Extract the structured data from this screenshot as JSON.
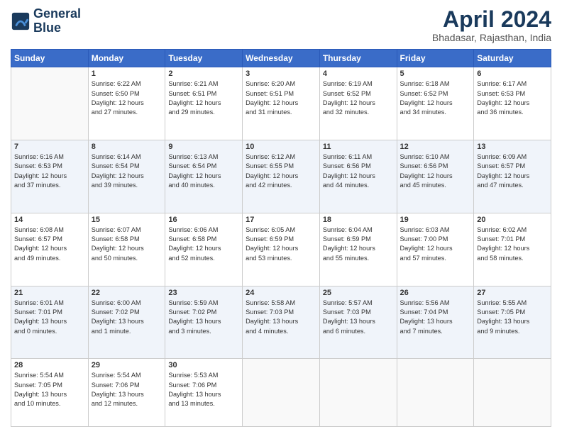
{
  "header": {
    "logo_line1": "General",
    "logo_line2": "Blue",
    "title": "April 2024",
    "location": "Bhadasar, Rajasthan, India"
  },
  "days_of_week": [
    "Sunday",
    "Monday",
    "Tuesday",
    "Wednesday",
    "Thursday",
    "Friday",
    "Saturday"
  ],
  "weeks": [
    [
      {
        "day": "",
        "info": ""
      },
      {
        "day": "1",
        "info": "Sunrise: 6:22 AM\nSunset: 6:50 PM\nDaylight: 12 hours\nand 27 minutes."
      },
      {
        "day": "2",
        "info": "Sunrise: 6:21 AM\nSunset: 6:51 PM\nDaylight: 12 hours\nand 29 minutes."
      },
      {
        "day": "3",
        "info": "Sunrise: 6:20 AM\nSunset: 6:51 PM\nDaylight: 12 hours\nand 31 minutes."
      },
      {
        "day": "4",
        "info": "Sunrise: 6:19 AM\nSunset: 6:52 PM\nDaylight: 12 hours\nand 32 minutes."
      },
      {
        "day": "5",
        "info": "Sunrise: 6:18 AM\nSunset: 6:52 PM\nDaylight: 12 hours\nand 34 minutes."
      },
      {
        "day": "6",
        "info": "Sunrise: 6:17 AM\nSunset: 6:53 PM\nDaylight: 12 hours\nand 36 minutes."
      }
    ],
    [
      {
        "day": "7",
        "info": "Sunrise: 6:16 AM\nSunset: 6:53 PM\nDaylight: 12 hours\nand 37 minutes."
      },
      {
        "day": "8",
        "info": "Sunrise: 6:14 AM\nSunset: 6:54 PM\nDaylight: 12 hours\nand 39 minutes."
      },
      {
        "day": "9",
        "info": "Sunrise: 6:13 AM\nSunset: 6:54 PM\nDaylight: 12 hours\nand 40 minutes."
      },
      {
        "day": "10",
        "info": "Sunrise: 6:12 AM\nSunset: 6:55 PM\nDaylight: 12 hours\nand 42 minutes."
      },
      {
        "day": "11",
        "info": "Sunrise: 6:11 AM\nSunset: 6:56 PM\nDaylight: 12 hours\nand 44 minutes."
      },
      {
        "day": "12",
        "info": "Sunrise: 6:10 AM\nSunset: 6:56 PM\nDaylight: 12 hours\nand 45 minutes."
      },
      {
        "day": "13",
        "info": "Sunrise: 6:09 AM\nSunset: 6:57 PM\nDaylight: 12 hours\nand 47 minutes."
      }
    ],
    [
      {
        "day": "14",
        "info": "Sunrise: 6:08 AM\nSunset: 6:57 PM\nDaylight: 12 hours\nand 49 minutes."
      },
      {
        "day": "15",
        "info": "Sunrise: 6:07 AM\nSunset: 6:58 PM\nDaylight: 12 hours\nand 50 minutes."
      },
      {
        "day": "16",
        "info": "Sunrise: 6:06 AM\nSunset: 6:58 PM\nDaylight: 12 hours\nand 52 minutes."
      },
      {
        "day": "17",
        "info": "Sunrise: 6:05 AM\nSunset: 6:59 PM\nDaylight: 12 hours\nand 53 minutes."
      },
      {
        "day": "18",
        "info": "Sunrise: 6:04 AM\nSunset: 6:59 PM\nDaylight: 12 hours\nand 55 minutes."
      },
      {
        "day": "19",
        "info": "Sunrise: 6:03 AM\nSunset: 7:00 PM\nDaylight: 12 hours\nand 57 minutes."
      },
      {
        "day": "20",
        "info": "Sunrise: 6:02 AM\nSunset: 7:01 PM\nDaylight: 12 hours\nand 58 minutes."
      }
    ],
    [
      {
        "day": "21",
        "info": "Sunrise: 6:01 AM\nSunset: 7:01 PM\nDaylight: 13 hours\nand 0 minutes."
      },
      {
        "day": "22",
        "info": "Sunrise: 6:00 AM\nSunset: 7:02 PM\nDaylight: 13 hours\nand 1 minute."
      },
      {
        "day": "23",
        "info": "Sunrise: 5:59 AM\nSunset: 7:02 PM\nDaylight: 13 hours\nand 3 minutes."
      },
      {
        "day": "24",
        "info": "Sunrise: 5:58 AM\nSunset: 7:03 PM\nDaylight: 13 hours\nand 4 minutes."
      },
      {
        "day": "25",
        "info": "Sunrise: 5:57 AM\nSunset: 7:03 PM\nDaylight: 13 hours\nand 6 minutes."
      },
      {
        "day": "26",
        "info": "Sunrise: 5:56 AM\nSunset: 7:04 PM\nDaylight: 13 hours\nand 7 minutes."
      },
      {
        "day": "27",
        "info": "Sunrise: 5:55 AM\nSunset: 7:05 PM\nDaylight: 13 hours\nand 9 minutes."
      }
    ],
    [
      {
        "day": "28",
        "info": "Sunrise: 5:54 AM\nSunset: 7:05 PM\nDaylight: 13 hours\nand 10 minutes."
      },
      {
        "day": "29",
        "info": "Sunrise: 5:54 AM\nSunset: 7:06 PM\nDaylight: 13 hours\nand 12 minutes."
      },
      {
        "day": "30",
        "info": "Sunrise: 5:53 AM\nSunset: 7:06 PM\nDaylight: 13 hours\nand 13 minutes."
      },
      {
        "day": "",
        "info": ""
      },
      {
        "day": "",
        "info": ""
      },
      {
        "day": "",
        "info": ""
      },
      {
        "day": "",
        "info": ""
      }
    ]
  ]
}
